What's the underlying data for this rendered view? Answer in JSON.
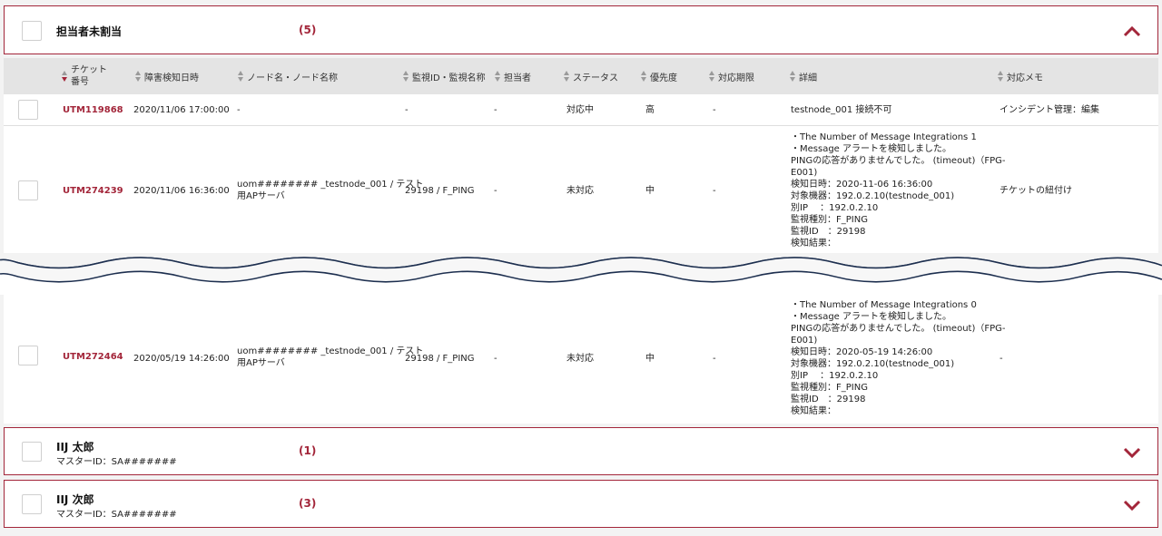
{
  "groups": [
    {
      "title": "担当者未割当",
      "subtitle": "",
      "count": "(5)"
    },
    {
      "title": "IIJ 太郎",
      "subtitle": "マスターID：SA#######",
      "count": "(1)"
    },
    {
      "title": "IIJ 次郎",
      "subtitle": "マスターID：SA#######",
      "count": "(3)"
    }
  ],
  "columns": {
    "ticket": "チケット\n番号",
    "ticket_l1": "チケット",
    "ticket_l2": "番号",
    "detected": "障害検知日時",
    "node": "ノード名・ノード名称",
    "monitor": "監視ID・監視名称",
    "assignee": "担当者",
    "status": "ステータス",
    "priority": "優先度",
    "deadline": "対応期限",
    "detail": "詳細",
    "memo": "対応メモ"
  },
  "rows": [
    {
      "ticket": "UTM119868",
      "detected": "2020/11/06 17:00:00",
      "node": "-",
      "monitor": "-",
      "assignee": "-",
      "status": "対応中",
      "priority": "高",
      "deadline": "-",
      "detail": "testnode_001 接続不可",
      "memo": "インシデント管理：編集"
    },
    {
      "ticket": "UTM274239",
      "detected": "2020/11/06 16:36:00",
      "node_l1": "uom######## _testnode_001 / テスト",
      "node_l2": "用APサーバ",
      "monitor": "29198 / F_PING",
      "assignee": "-",
      "status": "未対応",
      "priority": "中",
      "deadline": "-",
      "detail": "・The Number of Message Integrations 1\n・Message アラートを検知しました。\nPINGの応答がありませんでした。 (timeout)（FPG-\nE001)\n検知日時：2020-11-06 16:36:00\n対象機器：192.0.2.10(testnode_001)\n別IP　 ：192.0.2.10\n監視種別：F_PING\n監視ID　：29198\n検知結果：",
      "memo": "チケットの紐付け"
    },
    {
      "ticket": "UTM272464",
      "detected": "2020/05/19 14:26:00",
      "node_l1": "uom######## _testnode_001 / テスト",
      "node_l2": "用APサーバ",
      "monitor": "29198 / F_PING",
      "assignee": "-",
      "status": "未対応",
      "priority": "中",
      "deadline": "-",
      "detail": "・The Number of Message Integrations 0\n・Message アラートを検知しました。\nPINGの応答がありませんでした。 (timeout)（FPG-\nE001)\n検知日時：2020-05-19 14:26:00\n対象機器：192.0.2.10(testnode_001)\n別IP　 ：192.0.2.10\n監視種別：F_PING\n監視ID　：29198\n検知結果：",
      "memo": "-"
    }
  ],
  "icons": {
    "collapse": "chevron-up-icon",
    "expand": "chevron-down-icon",
    "sort": "sort-icon"
  },
  "colors": {
    "accent": "#a3263a",
    "header_bg": "#e4e4e4",
    "wave": "#1d2f4f"
  }
}
